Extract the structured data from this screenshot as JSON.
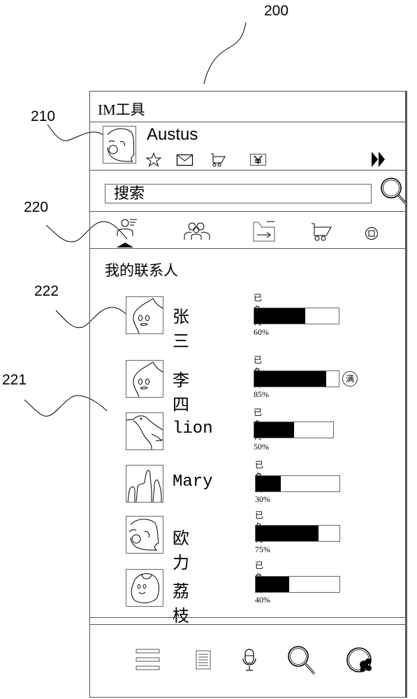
{
  "reference_labels": {
    "device": "200",
    "user_avatar": "210",
    "tab_bar": "220",
    "contact_list": "221",
    "contact_avatar": "222"
  },
  "app": {
    "title": "IM工具"
  },
  "profile": {
    "username": "Austus",
    "status_icons": [
      "star-icon",
      "mail-icon",
      "cart-icon",
      "yuan-icon"
    ],
    "expand_icon": "double-arrow-right-icon"
  },
  "search": {
    "placeholder": "搜索",
    "button_icon": "search-icon"
  },
  "tabs": [
    {
      "icon": "contacts-icon",
      "active": true
    },
    {
      "icon": "group-icon",
      "active": false
    },
    {
      "icon": "folder-transfer-icon",
      "active": false
    },
    {
      "icon": "cart-icon",
      "active": false
    },
    {
      "icon": "stop-icon",
      "active": false
    }
  ],
  "section": {
    "title": "我的联系人"
  },
  "contacts": [
    {
      "name": "张三",
      "load_label": "已负荷 60%",
      "load": 60,
      "full": false,
      "avatar": "ghost-avatar"
    },
    {
      "name": "李四",
      "load_label": "已负荷 85%",
      "load": 85,
      "full": true,
      "full_label": "满",
      "avatar": "ghost-avatar"
    },
    {
      "name": "lion",
      "load_label": "已负荷 50%",
      "load": 50,
      "full": false,
      "avatar": "bird-avatar"
    },
    {
      "name": "Mary",
      "load_label": "已负荷 30%",
      "load": 30,
      "full": false,
      "avatar": "castle-avatar"
    },
    {
      "name": "欧力",
      "load_label": "已负荷 75%",
      "load": 75,
      "full": false,
      "avatar": "face-avatar"
    },
    {
      "name": "荔枝",
      "load_label": "已负荷 40%",
      "load": 40,
      "full": false,
      "avatar": "lychee-avatar"
    }
  ],
  "bottom_bar": [
    {
      "icon": "menu-icon"
    },
    {
      "icon": "document-icon"
    },
    {
      "icon": "microphone-icon"
    },
    {
      "icon": "search-icon"
    },
    {
      "icon": "settings-blob-icon"
    }
  ]
}
